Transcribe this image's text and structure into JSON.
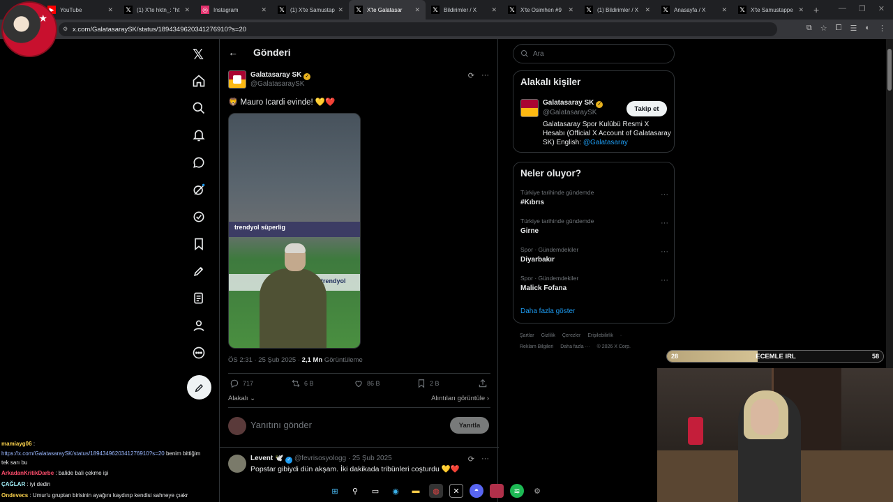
{
  "browser": {
    "tabs": [
      {
        "title": "YouTube",
        "icon": "youtube-icon",
        "color": "#ff0000"
      },
      {
        "title": "(1) X'te hktn_: \"ht",
        "icon": "x-icon",
        "color": "#000000"
      },
      {
        "title": "Instagram",
        "icon": "instagram-icon",
        "color": "#e1306c"
      },
      {
        "title": "(1) X'te Samustap",
        "icon": "x-icon",
        "color": "#000000"
      },
      {
        "title": "X'te Galatasar",
        "icon": "x-icon",
        "color": "#000000",
        "active": true
      },
      {
        "title": "Bildirimler / X",
        "icon": "x-icon",
        "color": "#000000"
      },
      {
        "title": "X'te Osimhen #9",
        "icon": "x-icon",
        "color": "#000000"
      },
      {
        "title": "(1) Bildirimler / X",
        "icon": "x-icon",
        "color": "#000000"
      },
      {
        "title": "Anasayfa / X",
        "icon": "x-icon",
        "color": "#000000"
      },
      {
        "title": "X'te Samustappe",
        "icon": "x-icon",
        "color": "#000000"
      }
    ],
    "url": "x.com/GalatasaraySK/status/1894349620341276910?s=20"
  },
  "header": {
    "title": "Gönderi"
  },
  "post": {
    "author_name": "Galatasaray SK",
    "author_handle": "@GalatasaraySK",
    "text_prefix": "🦁 Mauro Icardi evinde! ",
    "heart1": "💛",
    "heart2": "❤️",
    "media_board_text": "trendyol süperlig",
    "media_board2_text": "trendyol",
    "meta_time": "ÖS 2:31 · 25 Şub 2025 · ",
    "meta_views": "2,1 Mn",
    "meta_views_label": " Görüntüleme",
    "replies": "717",
    "reposts": "6 B",
    "likes": "86 B",
    "bookmarks": "2 B",
    "relevance_label": "Alakalı",
    "quotes_label": "Alıntıları görüntüle"
  },
  "reply_box": {
    "placeholder": "Yanıtını gönder",
    "button": "Yanıtla"
  },
  "reply": {
    "name": "Levent 🕊️",
    "handle": "@fevrisosyologg · 25 Şub 2025",
    "text": "Popstar gibiydi dün akşam. İki dakikada tribünleri coşturdu 💛❤️"
  },
  "search": {
    "placeholder": "Ara"
  },
  "related": {
    "title": "Alakalı kişiler",
    "name": "Galatasaray SK",
    "handle": "@GalatasaraySK",
    "follow": "Takip et",
    "bio": "Galatasaray Spor Kulübü Resmi X Hesabı (Official X Account of Galatasaray SK) English: ",
    "bio_link": "@Galatasaray"
  },
  "trends": {
    "title": "Neler oluyor?",
    "items": [
      {
        "context": "Türkiye tarihinde gündemde",
        "name": "#Kıbrıs"
      },
      {
        "context": "Türkiye tarihinde gündemde",
        "name": "Girne"
      },
      {
        "context": "Spor · Gündemdekiler",
        "name": "Diyarbakır"
      },
      {
        "context": "Spor · Gündemdekiler",
        "name": "Malick Fofana"
      }
    ],
    "more": "Daha fazla göster"
  },
  "footer": {
    "row1": [
      "Şartlar",
      "Gizlilik",
      "Çerezler",
      "Erişilebilirlik",
      "·"
    ],
    "row2": [
      "Reklam Bilgileri",
      "Daha fazla ···",
      "© 2026 X Corp."
    ]
  },
  "overlay": {
    "xp_left": "28",
    "xp_center": "ECEMLE IRL",
    "xp_right": "58",
    "xp_progress": 0.42
  },
  "chat": [
    {
      "user": "mamiayg06",
      "sep": " :",
      "msg": ""
    },
    {
      "user": "",
      "sep": "",
      "link": "https://x.com/GalatasaraySK/status/1894349620341276910?s=20",
      "msg": " benim bittiğim"
    },
    {
      "user": "",
      "sep": "",
      "msg": "tek sarı bu"
    },
    {
      "user": "ArkadanKritikDarbe",
      "sep": " : ",
      "msg": "balide bali çekme işi"
    },
    {
      "user": "ÇAĞLAR",
      "sep": " : ",
      "msg": "iyi dedin"
    },
    {
      "user": "Ondevecs",
      "sep": " : ",
      "msg": "Umur'u gruptan birisinin ayağını kaydırıp kendisi sahneye çıakr"
    }
  ]
}
